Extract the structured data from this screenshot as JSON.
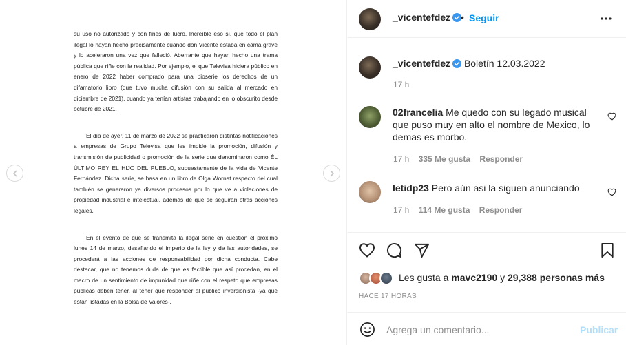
{
  "document": {
    "paragraphs": [
      "su uso no autorizado y con fines de lucro. Increíble eso sí, que todo el plan ilegal lo hayan hecho precisamente cuando don Vicente estaba en cama grave y lo aceleraron una vez que falleció. Aberrante que hayan hecho una trama pública que riñe con la realidad. Por ejemplo, el que Televisa hiciera público en enero de 2022 haber comprado para una bioserie los derechos de un difamatorio libro (que tuvo mucha difusión con su salida al mercado en diciembre de 2021), cuando ya tenían artistas trabajando en  lo obscurito desde octubre de 2021.",
      "El día de ayer, 11 de marzo de 2022 se practicaron distintas notificaciones a empresas de Grupo Televisa que les impide la promoción, difusión y transmisión de publicidad o promoción de la serie que denominaron como ÉL ÚLTIMO REY EL HIJO DEL PUEBLO, supuestamente de la vida de Vicente Fernández. Dicha serie, se basa en un libro de Olga Wornat respecto del cual también se generaron ya diversos procesos por lo que ve a violaciones de propiedad industrial e intelectual, además de que se seguirán otras acciones legales.",
      "En el evento de que se transmita la ilegal serie en cuestión el próximo lunes 14 de marzo, desafiando el imperio de la ley y de las autoridades, se procederá a las acciones de responsabilidad por dicha conducta. Cabe destacar, que no tenemos duda de que es factible que así procedan, en el macro de un sentimiento de impunidad que riñe con el respeto que empresas públicas deben tener, al tener que responder al público inversionista -ya que están listadas en la Bolsa de Valores-."
    ]
  },
  "header": {
    "username": "_vicentefdez",
    "dot": "•",
    "follow_label": "Seguir"
  },
  "caption": {
    "username": "_vicentefdez",
    "text": "Boletín 12.03.2022",
    "time": "17 h"
  },
  "comments": [
    {
      "username": "02francelia",
      "text": "Me quedo con su legado musical que puso muy en alto el nombre de Mexico, lo demas es morbo.",
      "time": "17 h",
      "likes": "335 Me gusta",
      "reply": "Responder"
    },
    {
      "username": "letidp23",
      "text": "Pero aún asi la siguen anunciando",
      "time": "17 h",
      "likes": "114 Me gusta",
      "reply": "Responder"
    }
  ],
  "likes": {
    "prefix": "Les gusta a",
    "user": "mavc2190",
    "conj": "y",
    "others": "29,388 personas más"
  },
  "time_ago": "HACE 17 HORAS",
  "comment_box": {
    "placeholder": "Agrega un comentario...",
    "publish_label": "Publicar"
  },
  "colors": {
    "accent": "#0095f6",
    "publish_disabled": "#b2dffc",
    "verified": "#3897f0",
    "muted": "#8e8e8e"
  },
  "icons": [
    "chevron-left-icon",
    "chevron-right-icon",
    "verified-icon",
    "more-icon",
    "heart-icon",
    "comment-icon",
    "share-icon",
    "bookmark-icon",
    "emoji-icon"
  ]
}
